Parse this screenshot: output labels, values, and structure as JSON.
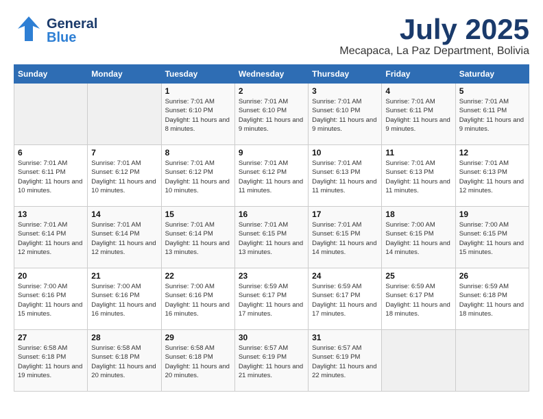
{
  "header": {
    "logo_general": "General",
    "logo_blue": "Blue",
    "month_title": "July 2025",
    "location": "Mecapaca, La Paz Department, Bolivia"
  },
  "weekdays": [
    "Sunday",
    "Monday",
    "Tuesday",
    "Wednesday",
    "Thursday",
    "Friday",
    "Saturday"
  ],
  "weeks": [
    [
      {
        "day": "",
        "info": ""
      },
      {
        "day": "",
        "info": ""
      },
      {
        "day": "1",
        "info": "Sunrise: 7:01 AM\nSunset: 6:10 PM\nDaylight: 11 hours and 8 minutes."
      },
      {
        "day": "2",
        "info": "Sunrise: 7:01 AM\nSunset: 6:10 PM\nDaylight: 11 hours and 9 minutes."
      },
      {
        "day": "3",
        "info": "Sunrise: 7:01 AM\nSunset: 6:10 PM\nDaylight: 11 hours and 9 minutes."
      },
      {
        "day": "4",
        "info": "Sunrise: 7:01 AM\nSunset: 6:11 PM\nDaylight: 11 hours and 9 minutes."
      },
      {
        "day": "5",
        "info": "Sunrise: 7:01 AM\nSunset: 6:11 PM\nDaylight: 11 hours and 9 minutes."
      }
    ],
    [
      {
        "day": "6",
        "info": "Sunrise: 7:01 AM\nSunset: 6:11 PM\nDaylight: 11 hours and 10 minutes."
      },
      {
        "day": "7",
        "info": "Sunrise: 7:01 AM\nSunset: 6:12 PM\nDaylight: 11 hours and 10 minutes."
      },
      {
        "day": "8",
        "info": "Sunrise: 7:01 AM\nSunset: 6:12 PM\nDaylight: 11 hours and 10 minutes."
      },
      {
        "day": "9",
        "info": "Sunrise: 7:01 AM\nSunset: 6:12 PM\nDaylight: 11 hours and 11 minutes."
      },
      {
        "day": "10",
        "info": "Sunrise: 7:01 AM\nSunset: 6:13 PM\nDaylight: 11 hours and 11 minutes."
      },
      {
        "day": "11",
        "info": "Sunrise: 7:01 AM\nSunset: 6:13 PM\nDaylight: 11 hours and 11 minutes."
      },
      {
        "day": "12",
        "info": "Sunrise: 7:01 AM\nSunset: 6:13 PM\nDaylight: 11 hours and 12 minutes."
      }
    ],
    [
      {
        "day": "13",
        "info": "Sunrise: 7:01 AM\nSunset: 6:14 PM\nDaylight: 11 hours and 12 minutes."
      },
      {
        "day": "14",
        "info": "Sunrise: 7:01 AM\nSunset: 6:14 PM\nDaylight: 11 hours and 12 minutes."
      },
      {
        "day": "15",
        "info": "Sunrise: 7:01 AM\nSunset: 6:14 PM\nDaylight: 11 hours and 13 minutes."
      },
      {
        "day": "16",
        "info": "Sunrise: 7:01 AM\nSunset: 6:15 PM\nDaylight: 11 hours and 13 minutes."
      },
      {
        "day": "17",
        "info": "Sunrise: 7:01 AM\nSunset: 6:15 PM\nDaylight: 11 hours and 14 minutes."
      },
      {
        "day": "18",
        "info": "Sunrise: 7:00 AM\nSunset: 6:15 PM\nDaylight: 11 hours and 14 minutes."
      },
      {
        "day": "19",
        "info": "Sunrise: 7:00 AM\nSunset: 6:15 PM\nDaylight: 11 hours and 15 minutes."
      }
    ],
    [
      {
        "day": "20",
        "info": "Sunrise: 7:00 AM\nSunset: 6:16 PM\nDaylight: 11 hours and 15 minutes."
      },
      {
        "day": "21",
        "info": "Sunrise: 7:00 AM\nSunset: 6:16 PM\nDaylight: 11 hours and 16 minutes."
      },
      {
        "day": "22",
        "info": "Sunrise: 7:00 AM\nSunset: 6:16 PM\nDaylight: 11 hours and 16 minutes."
      },
      {
        "day": "23",
        "info": "Sunrise: 6:59 AM\nSunset: 6:17 PM\nDaylight: 11 hours and 17 minutes."
      },
      {
        "day": "24",
        "info": "Sunrise: 6:59 AM\nSunset: 6:17 PM\nDaylight: 11 hours and 17 minutes."
      },
      {
        "day": "25",
        "info": "Sunrise: 6:59 AM\nSunset: 6:17 PM\nDaylight: 11 hours and 18 minutes."
      },
      {
        "day": "26",
        "info": "Sunrise: 6:59 AM\nSunset: 6:18 PM\nDaylight: 11 hours and 18 minutes."
      }
    ],
    [
      {
        "day": "27",
        "info": "Sunrise: 6:58 AM\nSunset: 6:18 PM\nDaylight: 11 hours and 19 minutes."
      },
      {
        "day": "28",
        "info": "Sunrise: 6:58 AM\nSunset: 6:18 PM\nDaylight: 11 hours and 20 minutes."
      },
      {
        "day": "29",
        "info": "Sunrise: 6:58 AM\nSunset: 6:18 PM\nDaylight: 11 hours and 20 minutes."
      },
      {
        "day": "30",
        "info": "Sunrise: 6:57 AM\nSunset: 6:19 PM\nDaylight: 11 hours and 21 minutes."
      },
      {
        "day": "31",
        "info": "Sunrise: 6:57 AM\nSunset: 6:19 PM\nDaylight: 11 hours and 22 minutes."
      },
      {
        "day": "",
        "info": ""
      },
      {
        "day": "",
        "info": ""
      }
    ]
  ]
}
